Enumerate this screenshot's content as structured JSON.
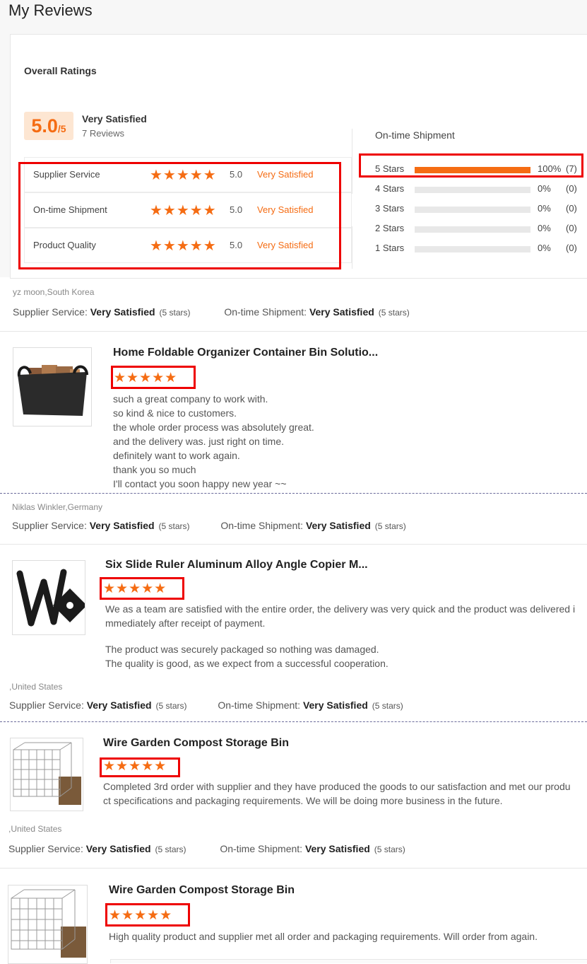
{
  "page": {
    "title": "My Reviews"
  },
  "summary": {
    "overall_label": "Overall Ratings",
    "score": "5.0",
    "score_max": "/5",
    "satisfaction": "Very Satisfied",
    "reviews_count": "7 Reviews",
    "ratings": [
      {
        "label": "Supplier Service",
        "stars": "★★★★★",
        "value": "5.0",
        "text": "Very Satisfied"
      },
      {
        "label": "On-time Shipment",
        "stars": "★★★★★",
        "value": "5.0",
        "text": "Very Satisfied"
      },
      {
        "label": "Product Quality",
        "stars": "★★★★★",
        "value": "5.0",
        "text": "Very Satisfied"
      }
    ]
  },
  "shipment": {
    "title": "On-time Shipment",
    "rows": [
      {
        "label": "5  Stars",
        "fraction": 1.0,
        "pct": "100%",
        "count": "(7)"
      },
      {
        "label": "4  Stars",
        "fraction": 0,
        "pct": "0%",
        "count": "(0)"
      },
      {
        "label": "3  Stars",
        "fraction": 0,
        "pct": "0%",
        "count": "(0)"
      },
      {
        "label": "2  Stars",
        "fraction": 0,
        "pct": "0%",
        "count": "(0)"
      },
      {
        "label": "1  Stars",
        "fraction": 0,
        "pct": "0%",
        "count": "(0)"
      }
    ]
  },
  "meta_labels": {
    "supplier": "Supplier Service:",
    "shipment": "On-time Shipment:",
    "very_satisfied": "Very Satisfied",
    "five_stars": "(5 stars)"
  },
  "reviews": [
    {
      "reviewer": "yz moon,South Korea",
      "product": "Home Foldable Organizer Container Bin Solutio...",
      "stars": "★★★★★",
      "lines": [
        "such a great company to work with.",
        "so kind & nice to customers.",
        "the whole order process was absolutely great.",
        "and the delivery was. just right on time.",
        "definitely want to work again.",
        "thank you so much",
        "I'll contact you soon happy new year ~~"
      ]
    },
    {
      "reviewer": "Niklas Winkler,Germany",
      "product": "Six Slide Ruler Aluminum Alloy Angle Copier M...",
      "stars": "★★★★★",
      "lines": [
        "We as a team are satisfied with the entire order, the delivery was very quick and the product was delivered i",
        "mmediately after receipt of payment.",
        "",
        "The product was securely packaged so nothing was damaged.",
        "The quality is good, as we expect from a successful cooperation."
      ]
    },
    {
      "reviewer": ",United States",
      "product": "Wire Garden Compost Storage Bin",
      "stars": "★★★★★",
      "lines": [
        "Completed 3rd order with supplier and they have produced the goods to our satisfaction and met our produ",
        "ct specifications and packaging requirements. We will be doing more business in the future."
      ]
    },
    {
      "reviewer": ",United States",
      "product": "Wire Garden Compost Storage Bin",
      "stars": "★★★★★",
      "lines": [
        "High quality product and supplier met all order and packaging requirements. Will order from again."
      ]
    }
  ],
  "colors": {
    "accent": "#f56c13",
    "highlight_box": "#e00000",
    "badge_bg": "#fde6d2"
  }
}
